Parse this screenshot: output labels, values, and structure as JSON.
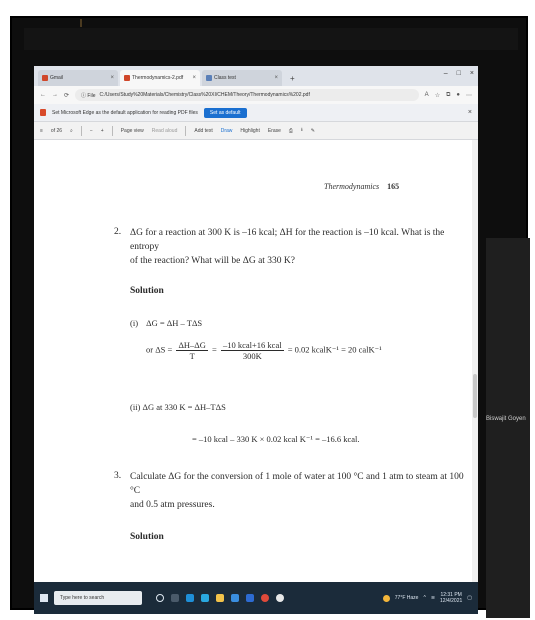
{
  "browser": {
    "tabs": [
      {
        "label": "Gmail",
        "active": false
      },
      {
        "label": "Thermodynamics-2.pdf",
        "active": true
      },
      {
        "label": "Class test",
        "active": false
      }
    ],
    "new_tab": "+",
    "window_controls": [
      "–",
      "□",
      "×"
    ],
    "url": "C:/Users/Study%20Materials/Chemistry/Class%20XI/CHEM/Theory/Thermodynamics%202.pdf",
    "nav": [
      "←",
      "→",
      "⟳",
      "ⓘ File"
    ],
    "notice_text": "Set Microsoft Edge as the default application for reading PDF files",
    "notice_button": "Set as default",
    "notice_close": "×"
  },
  "pdf_toolbar": {
    "page": "of 26",
    "items": [
      "−",
      "+",
      "Page view",
      "Read aloud",
      "Add text",
      "Draw",
      "Highlight",
      "Erase"
    ]
  },
  "document": {
    "running_header": "Thermodynamics",
    "page_number": "165",
    "q2_number": "2.",
    "q2_line1": "ΔG for a reaction at 300 K is –16 kcal; ΔH for the reaction is –10 kcal. What is the entropy",
    "q2_line2": "of the reaction? What will be ΔG at 330 K?",
    "solution_label": "Solution",
    "eq1_label": "(i)",
    "eq1": "ΔG = ΔH – TΔS",
    "eq2_prefix": "or  ΔS =",
    "eq2_frac1_num": "ΔH–ΔG",
    "eq2_frac1_den": "T",
    "eq2_eq": "=",
    "eq2_frac2_num": "–10 kcal+16 kcal",
    "eq2_frac2_den": "300K",
    "eq2_result": "= 0.02 kcalK⁻¹ = 20 calK⁻¹",
    "eq3": "(ii) ΔG at 330 K = ΔH–TΔS",
    "eq4": "= –10 kcal – 330 K × 0.02 kcal K⁻¹ = –16.6 kcal.",
    "q3_number": "3.",
    "q3_line1": "Calculate ΔG for the conversion of 1 mole of water at 100 °C and 1 atm to steam at 100 °C",
    "q3_line2": "and 0.5 atm pressures.",
    "solution_label_2": "Solution"
  },
  "taskbar": {
    "search_placeholder": "Type here to search",
    "tray_text": "77°F Haze",
    "time": "12:31 PM",
    "date": "12/4/2021"
  },
  "meeting": {
    "participant_name": "Biswajit Goyen"
  }
}
